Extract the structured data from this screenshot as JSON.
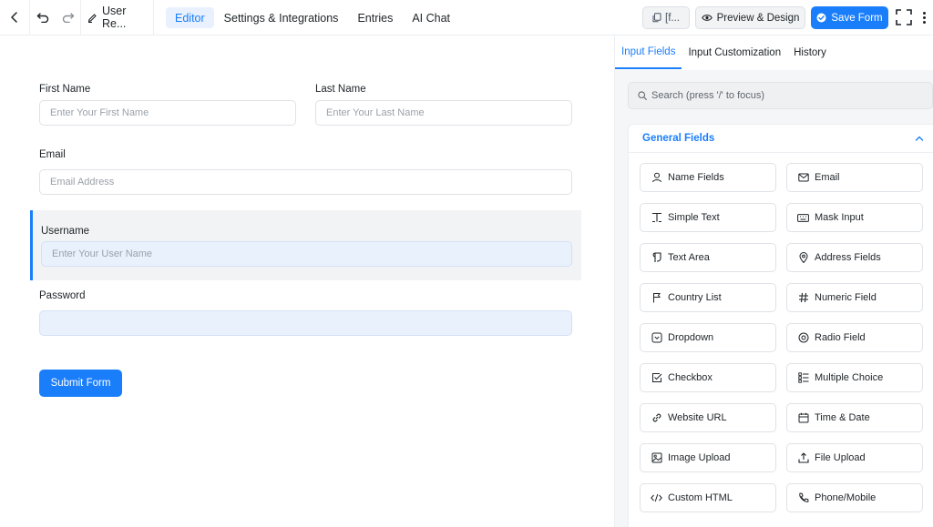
{
  "toolbar": {
    "form_title": "User Re...",
    "tabs": [
      "Editor",
      "Settings & Integrations",
      "Entries",
      "AI Chat"
    ],
    "shortcode_label": "[f...",
    "preview_label": "Preview & Design",
    "save_label": "Save Form"
  },
  "form": {
    "first_name": {
      "label": "First Name",
      "placeholder": "Enter Your First Name"
    },
    "last_name": {
      "label": "Last Name",
      "placeholder": "Enter Your Last Name"
    },
    "email": {
      "label": "Email",
      "placeholder": "Email Address"
    },
    "username": {
      "label": "Username",
      "placeholder": "Enter Your User Name"
    },
    "password": {
      "label": "Password",
      "placeholder": ""
    },
    "submit_label": "Submit Form"
  },
  "panel": {
    "tabs": [
      "Input Fields",
      "Input Customization",
      "History"
    ],
    "search_placeholder": "Search (press '/' to focus)",
    "section_title": "General Fields",
    "fields": [
      {
        "label": "Name Fields",
        "icon": "person-icon"
      },
      {
        "label": "Email",
        "icon": "envelope-icon"
      },
      {
        "label": "Simple Text",
        "icon": "text-cursor-icon"
      },
      {
        "label": "Mask Input",
        "icon": "keyboard-icon"
      },
      {
        "label": "Text Area",
        "icon": "paragraph-icon"
      },
      {
        "label": "Address Fields",
        "icon": "map-pin-icon"
      },
      {
        "label": "Country List",
        "icon": "flag-icon"
      },
      {
        "label": "Numeric Field",
        "icon": "hash-icon"
      },
      {
        "label": "Dropdown",
        "icon": "dropdown-icon"
      },
      {
        "label": "Radio Field",
        "icon": "radio-icon"
      },
      {
        "label": "Checkbox",
        "icon": "checkbox-icon"
      },
      {
        "label": "Multiple Choice",
        "icon": "list-icon"
      },
      {
        "label": "Website URL",
        "icon": "link-icon"
      },
      {
        "label": "Time & Date",
        "icon": "calendar-icon"
      },
      {
        "label": "Image Upload",
        "icon": "image-icon"
      },
      {
        "label": "File Upload",
        "icon": "upload-icon"
      },
      {
        "label": "Custom HTML",
        "icon": "code-icon"
      },
      {
        "label": "Phone/Mobile",
        "icon": "phone-icon"
      }
    ]
  },
  "colors": {
    "accent": "#1a7efb",
    "selected_bg": "#f2f3f5",
    "input_highlight": "#e9f1fd"
  }
}
